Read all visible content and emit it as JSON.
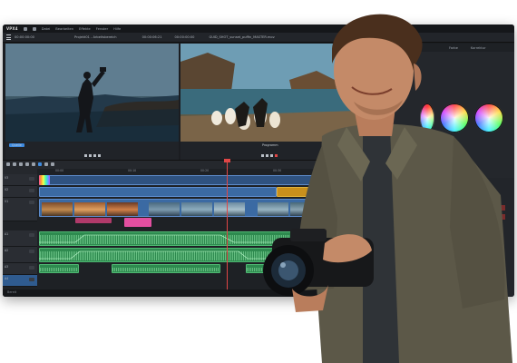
{
  "app": {
    "logo": "VPX4",
    "menu": [
      "Datei",
      "Bearbeiten",
      "Effekte",
      "Fenster",
      "Hilfe"
    ]
  },
  "toolbar": {
    "left_timecode": "00:00:00:00",
    "project_title": "Projekt01 - Arbeitsbereich",
    "center_timecode": "00:00:06:21",
    "right_timecode": "00:00:00:00",
    "file_title": "GUID_SHOT_sunset_puffin_MASTER.mov"
  },
  "color_panel": {
    "tabs": [
      "Farbe",
      "Korrektur"
    ]
  },
  "monitors": {
    "left_label": "Quelle",
    "right_label": "Programm"
  },
  "timeline": {
    "ruler": [
      "00:00",
      "00:10",
      "00:20",
      "00:30",
      "00:40"
    ],
    "tracks": [
      "V3",
      "V2",
      "V1",
      "A1",
      "A2",
      "A3",
      "A4"
    ],
    "status": "Bereit"
  },
  "colors": {
    "accent": "#3e8be0",
    "video_clip": "#3b6aa3",
    "audio_clip": "#2e8a4f",
    "playhead": "#e04646",
    "marker": "#e0b23a"
  }
}
